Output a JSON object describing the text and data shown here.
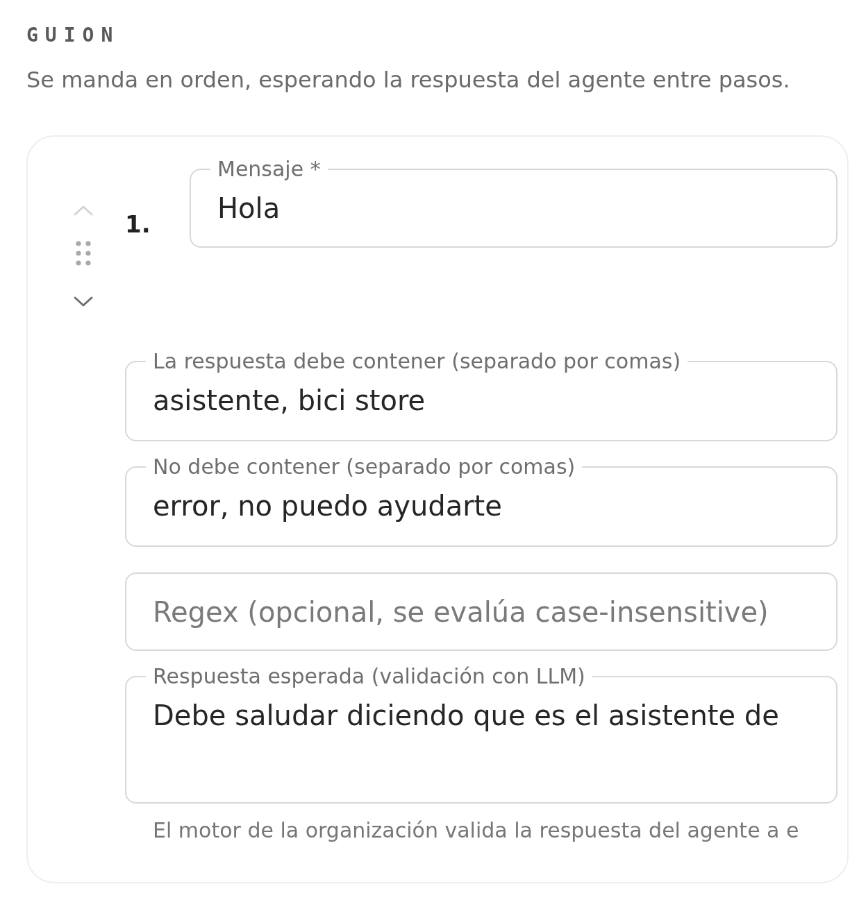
{
  "section": {
    "title": "GUION",
    "description": "Se manda en orden, esperando la respuesta del agente entre pasos."
  },
  "steps": [
    {
      "number": "1.",
      "move_up": {
        "disabled": true
      },
      "move_down": {
        "disabled": false
      },
      "message": {
        "label": "Mensaje *",
        "value": "Hola"
      },
      "checks": [
        {
          "kind": "input",
          "label": "La respuesta debe contener (separado por comas)",
          "value": "asistente, bici store"
        },
        {
          "kind": "input",
          "label": "No debe contener (separado por comas)",
          "value": "error, no puedo ayudarte"
        },
        {
          "kind": "input",
          "placeholder": "Regex (opcional, se evalúa case-insensitive)"
        },
        {
          "kind": "textarea",
          "label": "Respuesta esperada (validación con LLM)",
          "value": "Debe saludar diciendo que es el asistente de"
        }
      ],
      "note": "El motor de la organización valida la respuesta del agente a e"
    }
  ]
}
